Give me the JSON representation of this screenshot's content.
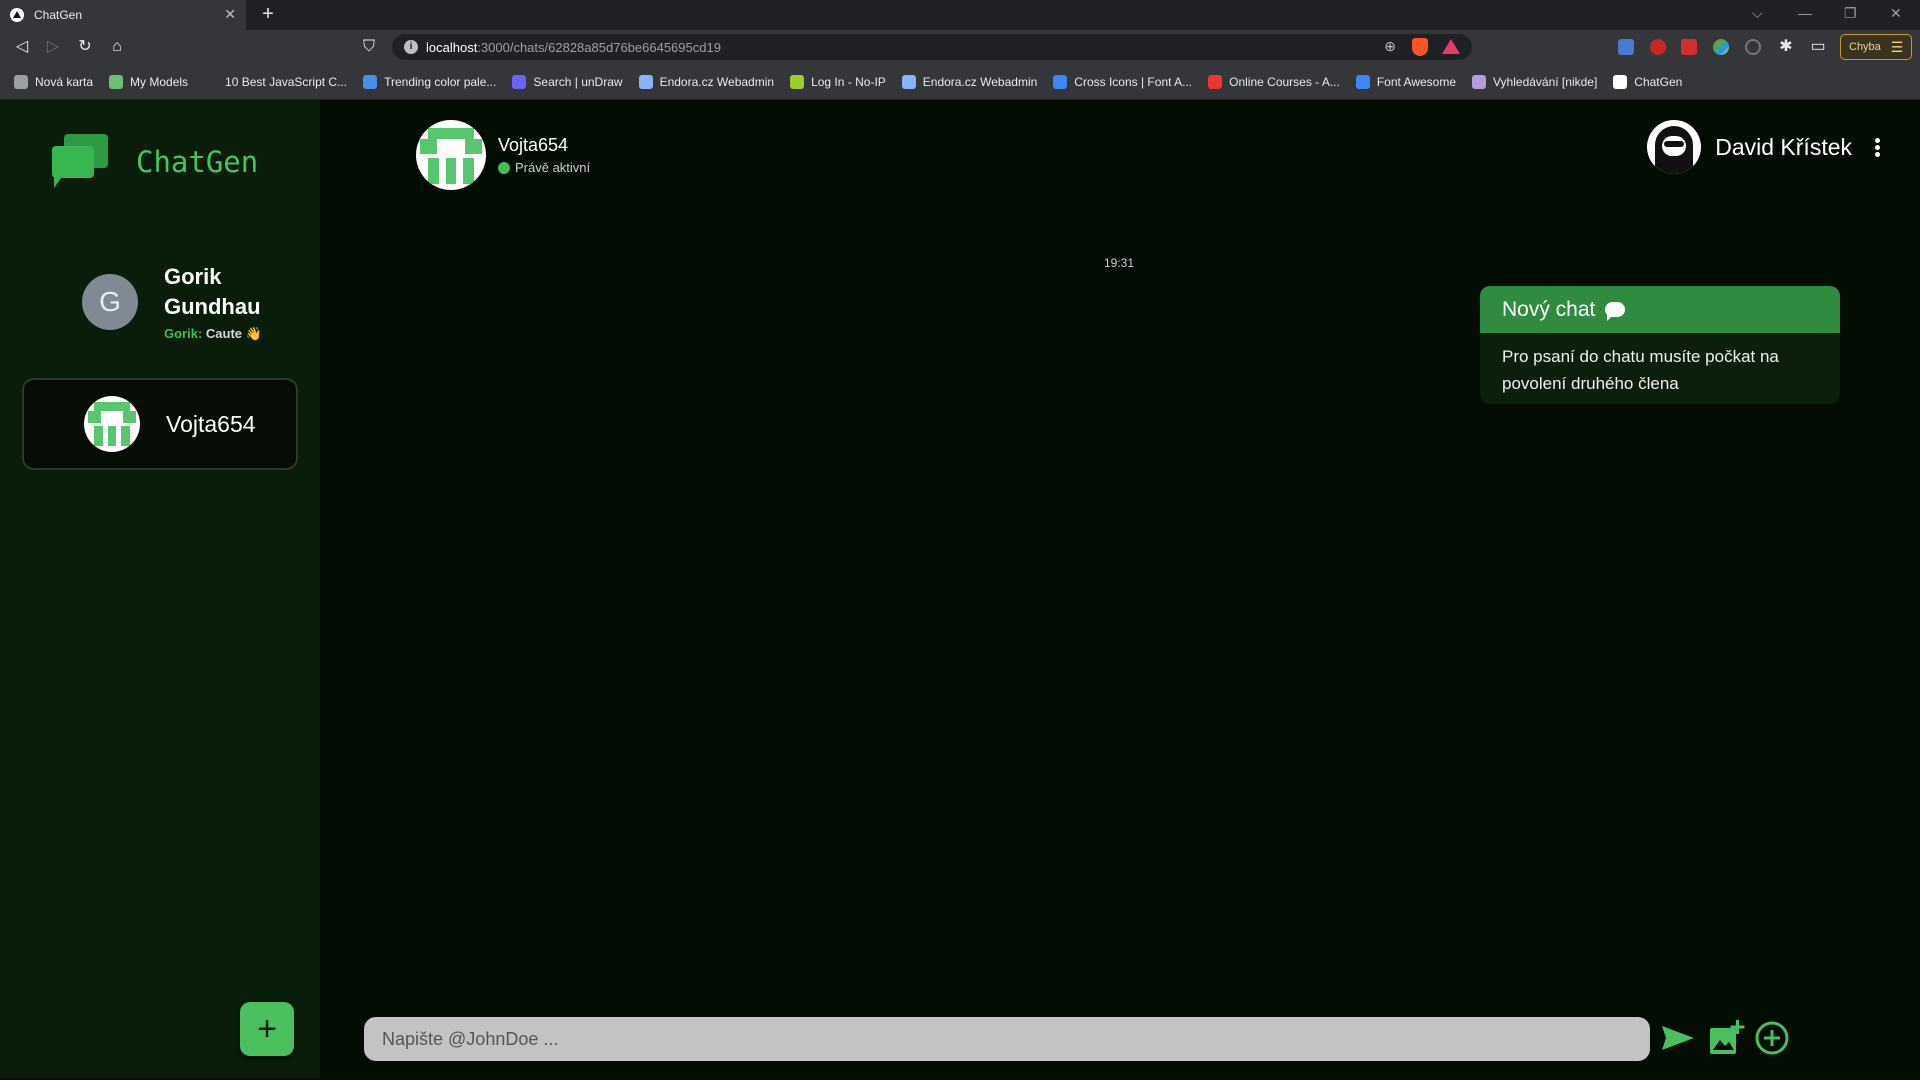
{
  "browser": {
    "tab_title": "ChatGen",
    "tab_close": "✕",
    "new_tab": "+",
    "url_host": "localhost",
    "url_path": ":3000/chats/62828a85d76be6645695cd19",
    "status_button": "Chyba",
    "bookmarks": [
      {
        "label": "Nová karta",
        "color": "#9aa0a6"
      },
      {
        "label": "My Models",
        "color": "#6fbf73"
      },
      {
        "label": "10 Best JavaScript C...",
        "color": "#35363a"
      },
      {
        "label": "Trending color pale...",
        "color": "#4a90e2"
      },
      {
        "label": "Search | unDraw",
        "color": "#6c63ff"
      },
      {
        "label": "Endora.cz Webadmin",
        "color": "#8ab4f8"
      },
      {
        "label": "Log In - No-IP",
        "color": "#9acd32"
      },
      {
        "label": "Endora.cz Webadmin",
        "color": "#8ab4f8"
      },
      {
        "label": "Cross Icons | Font A...",
        "color": "#4285f4"
      },
      {
        "label": "Online Courses - A...",
        "color": "#e53935"
      },
      {
        "label": "Font Awesome",
        "color": "#4285f4"
      },
      {
        "label": "Vyhledávání [nikde]",
        "color": "#b39ddb"
      },
      {
        "label": "ChatGen",
        "color": "#ffffff"
      }
    ]
  },
  "app": {
    "brand": "ChatGen",
    "chats": [
      {
        "avatar_letter": "G",
        "name": "Gorik Gundhau",
        "last_sender": "Gorik:",
        "last_message": "Caute 👋"
      },
      {
        "name": "Vojta654"
      }
    ],
    "add_button": "+"
  },
  "conversation": {
    "partner_name": "Vojta654",
    "partner_status": "Právě aktivní",
    "current_user": "David Křístek",
    "timestamp": "19:31",
    "system_message": {
      "title": "Nový chat",
      "body": "Pro psaní do chatu musíte počkat na povolení druhého člena"
    },
    "composer_placeholder": "Napište @JohnDoe ...",
    "colors": {
      "accent": "#49c05d",
      "card_header": "#2e8b40",
      "sidebar": "#0a1d0a",
      "main": "#030d03"
    }
  }
}
